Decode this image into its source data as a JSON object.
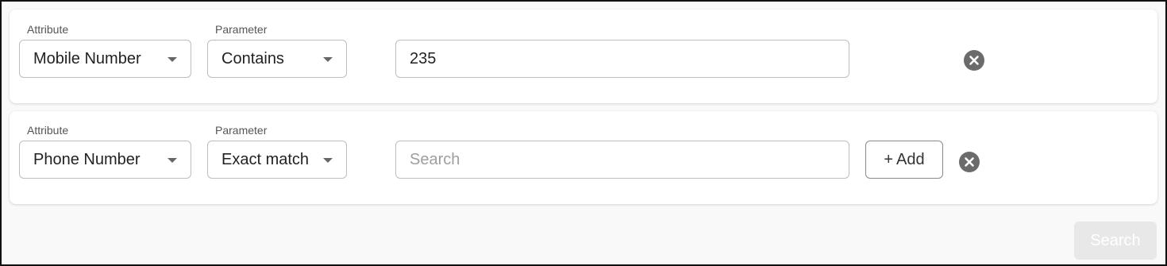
{
  "filters": [
    {
      "attribute_label": "Attribute",
      "attribute_value": "Mobile Number",
      "parameter_label": "Parameter",
      "parameter_value": "Contains",
      "input_value": "235",
      "input_placeholder": ""
    },
    {
      "attribute_label": "Attribute",
      "attribute_value": "Phone Number",
      "parameter_label": "Parameter",
      "parameter_value": "Exact match",
      "input_value": "",
      "input_placeholder": "Search",
      "add_label": "Add",
      "add_icon": "+"
    }
  ],
  "search_button_label": "Search",
  "icons": {
    "remove_row": "close-circle-icon",
    "dropdown": "chevron-down-icon",
    "add": "plus-icon"
  },
  "colors": {
    "icon_gray": "#6b6b6b",
    "border": "#bdbdbd",
    "search_disabled_bg": "#e8e8e8"
  }
}
